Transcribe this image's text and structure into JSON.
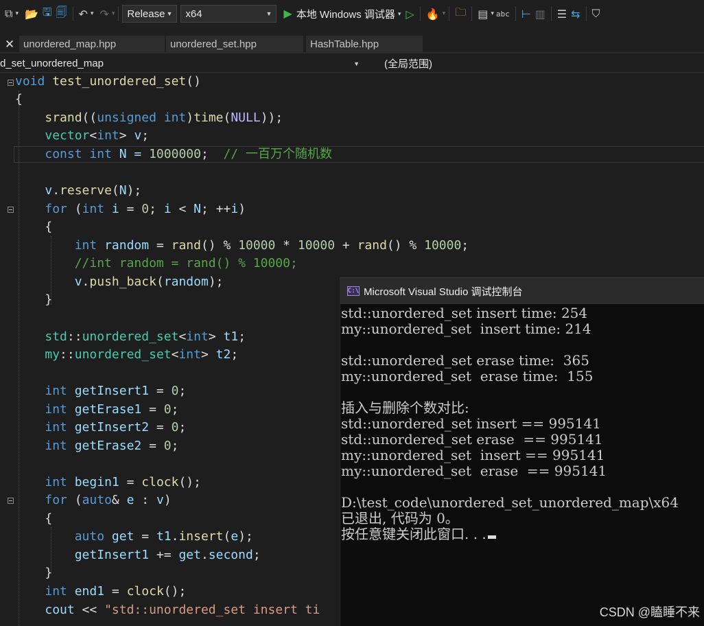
{
  "toolbar": {
    "config": "Release",
    "platform": "x64",
    "run_label": "本地 Windows 调试器",
    "icons": [
      "new-item-icon",
      "open-folder-icon",
      "save-icon",
      "save-all-icon",
      "undo-icon",
      "redo-icon",
      "run-no-debug-icon",
      "hot-reload-icon",
      "find-in-files-icon",
      "layout-icon",
      "spell-check-icon",
      "breakpoint-icon",
      "bookmark-icon"
    ]
  },
  "tabs": [
    {
      "label": "unordered_map.hpp"
    },
    {
      "label": "unordered_set.hpp"
    },
    {
      "label": "HashTable.hpp"
    }
  ],
  "nav": {
    "scope_left": "d_set_unordered_map",
    "scope_right": "(全局范围)"
  },
  "code": {
    "l1_kw": "void",
    "l1_fn": "test_unordered_set",
    "l1_rest": "()",
    "l2": "{",
    "l3": {
      "a": "srand",
      "b": "((",
      "c": "unsigned",
      "d": " ",
      "e": "int",
      "f": ")",
      "g": "time",
      "h": "(",
      "i": "NULL",
      "j": "));"
    },
    "l4": {
      "a": "vector",
      "b": "<",
      "c": "int",
      "d": "> ",
      "e": "v",
      "f": ";"
    },
    "l5": {
      "a": "const",
      "b": " ",
      "c": "int",
      "d": " N = ",
      "e": "1000000",
      "f": ";  ",
      "g": "// 一百万个随机数"
    },
    "l7": {
      "a": "v",
      "b": ".",
      "c": "reserve",
      "d": "(",
      "e": "N",
      "f": ");"
    },
    "l8": {
      "a": "for",
      "b": " (",
      "c": "int",
      "d": " ",
      "e": "i",
      "f": " = ",
      "g": "0",
      "h": "; ",
      "i": "i",
      "j": " < ",
      "k": "N",
      "l": "; ++",
      "m": "i",
      "n": ")"
    },
    "l9": "{",
    "l10": {
      "a": "int",
      "b": " ",
      "c": "random",
      "d": " = ",
      "e": "rand",
      "f": "() % ",
      "g": "10000",
      "h": " * ",
      "i": "10000",
      "j": " + ",
      "k": "rand",
      "l": "() % ",
      "m": "10000",
      "n": ";"
    },
    "l11": "//int random = rand() % 10000;",
    "l12": {
      "a": "v",
      "b": ".",
      "c": "push_back",
      "d": "(",
      "e": "random",
      "f": ");"
    },
    "l13": "}",
    "l15": {
      "a": "std",
      "b": "::",
      "c": "unordered_set",
      "d": "<",
      "e": "int",
      "f": "> ",
      "g": "t1",
      "h": ";"
    },
    "l16": {
      "a": "my",
      "b": "::",
      "c": "unordered_set",
      "d": "<",
      "e": "int",
      "f": "> ",
      "g": "t2",
      "h": ";"
    },
    "l18": {
      "a": "int",
      "b": "getInsert1",
      "c": " = ",
      "d": "0",
      "e": ";"
    },
    "l19": {
      "a": "int",
      "b": "getErase1",
      "c": " = ",
      "d": "0",
      "e": ";"
    },
    "l20": {
      "a": "int",
      "b": "getInsert2",
      "c": " = ",
      "d": "0",
      "e": ";"
    },
    "l21": {
      "a": "int",
      "b": "getErase2",
      "c": " = ",
      "d": "0",
      "e": ";"
    },
    "l23": {
      "a": "int",
      "b": "begin1",
      "c": " = ",
      "d": "clock",
      "e": "();"
    },
    "l24": {
      "a": "for",
      "b": " (",
      "c": "auto",
      "d": "& ",
      "e": "e",
      "f": " : ",
      "g": "v",
      "h": ")"
    },
    "l25": "{",
    "l26": {
      "a": "auto",
      "b": " ",
      "c": "get",
      "d": " = ",
      "e": "t1",
      "f": ".",
      "g": "insert",
      "h": "(",
      "i": "e",
      "j": ");"
    },
    "l27": {
      "a": "getInsert1",
      "b": " += ",
      "c": "get",
      "d": ".",
      "e": "second",
      "f": ";"
    },
    "l28": "}",
    "l29": {
      "a": "int",
      "b": "end1",
      "c": " = ",
      "d": "clock",
      "e": "();"
    },
    "l30": {
      "a": "cout",
      "b": " << ",
      "c": "\"std::unordered_set insert ti"
    }
  },
  "console": {
    "title": "Microsoft Visual Studio 调试控制台",
    "icon_text": "C:\\",
    "lines": [
      "std::unordered_set insert time: 254",
      "my::unordered_set  insert time: 214",
      "",
      "std::unordered_set erase time:  365",
      "my::unordered_set  erase time:  155",
      "",
      "插入与删除个数对比:",
      "std::unordered_set insert == 995141",
      "std::unordered_set erase  == 995141",
      "my::unordered_set  insert == 995141",
      "my::unordered_set  erase  == 995141",
      "",
      "D:\\test_code\\unordered_set_unordered_map\\x64",
      "已退出, 代码为 0。",
      "按任意键关闭此窗口. . ."
    ]
  },
  "watermark": "CSDN @瞌睡不来"
}
